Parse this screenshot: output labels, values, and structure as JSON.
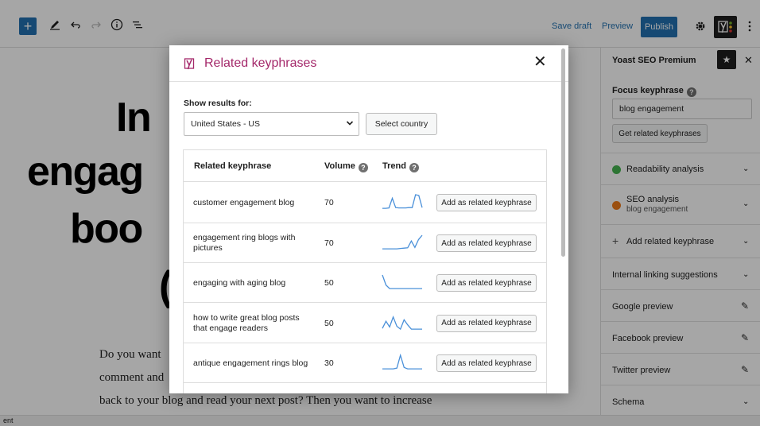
{
  "toolbar": {
    "save_draft": "Save draft",
    "preview": "Preview",
    "publish": "Publish",
    "accent": "#2271b1"
  },
  "canvas": {
    "heading_lines": [
      "In",
      "engag",
      "boo",
      "("
    ],
    "paragraph_lines": [
      "Do you want",
      "comment and",
      "back to your blog and read your next post? Then you want to increase"
    ]
  },
  "sidebar": {
    "title": "Yoast SEO Premium",
    "focus_label": "Focus keyphrase",
    "focus_value": "blog engagement",
    "get_related_label": "Get related keyphrases",
    "readability": "Readability analysis",
    "seo_analysis": "SEO analysis",
    "seo_sub": "blog engagement",
    "add_related": "Add related keyphrase",
    "internal_linking": "Internal linking suggestions",
    "google_preview": "Google preview",
    "facebook_preview": "Facebook preview",
    "twitter_preview": "Twitter preview",
    "schema": "Schema",
    "readability_color": "#46b450",
    "seo_color": "#ee7c1b"
  },
  "statusbar": {
    "text": "ent"
  },
  "modal": {
    "title": "Related keyphrases",
    "brand_color": "#a4286a",
    "show_results_label": "Show results for:",
    "country_value": "United States - US",
    "select_country": "Select country",
    "columns": {
      "keyphrase": "Related keyphrase",
      "volume": "Volume",
      "trend": "Trend"
    },
    "add_button": "Add as related keyphrase",
    "trend_color": "#4a90d9",
    "rows": [
      {
        "keyphrase": "customer engagement blog",
        "volume": "70",
        "trend": [
          0.05,
          0.05,
          0.08,
          0.75,
          0.1,
          0.08,
          0.08,
          0.08,
          0.1,
          0.1,
          1.0,
          0.95,
          0.1
        ]
      },
      {
        "keyphrase": "engagement ring blogs with pictures",
        "volume": "70",
        "trend": [
          0.05,
          0.05,
          0.05,
          0.05,
          0.05,
          0.08,
          0.1,
          0.12,
          0.6,
          0.15,
          0.7,
          1.0
        ]
      },
      {
        "keyphrase": "engaging with aging blog",
        "volume": "50",
        "trend": [
          1.0,
          0.3,
          0.05,
          0.05,
          0.05,
          0.05,
          0.05,
          0.05,
          0.05,
          0.05,
          0.05,
          0.05
        ]
      },
      {
        "keyphrase": "how to write great blog posts that engage readers",
        "volume": "50",
        "trend": [
          0.1,
          0.6,
          0.2,
          0.9,
          0.25,
          0.05,
          0.7,
          0.35,
          0.05,
          0.05,
          0.05,
          0.05
        ]
      },
      {
        "keyphrase": "antique engagement rings blog",
        "volume": "30",
        "trend": [
          0.05,
          0.05,
          0.05,
          0.05,
          0.1,
          1.0,
          0.15,
          0.05,
          0.05,
          0.05,
          0.05,
          0.05
        ]
      }
    ]
  }
}
